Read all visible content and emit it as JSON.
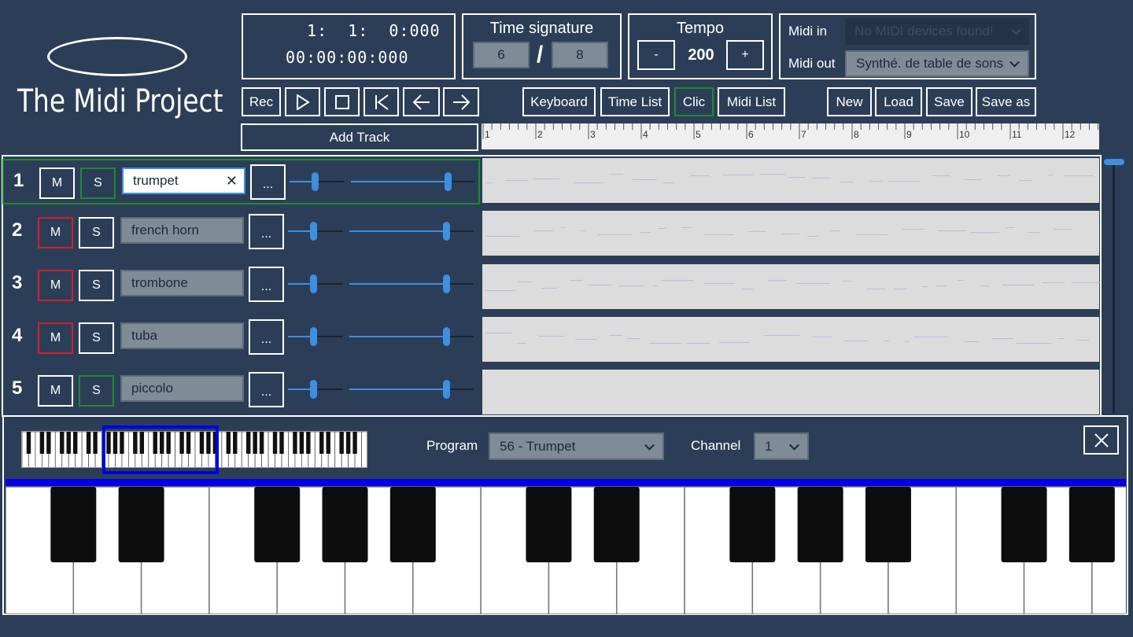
{
  "app": {
    "title": "The Midi Project"
  },
  "time": {
    "position": " 1:  1:  0:000",
    "clock": "00:00:00:000"
  },
  "time_signature": {
    "title": "Time signature",
    "numerator": "6",
    "separator": "/",
    "denominator": "8"
  },
  "tempo": {
    "title": "Tempo",
    "minus_label": "-",
    "value": "200",
    "plus_label": "+"
  },
  "midi": {
    "in_label": "Midi in",
    "in_value": "No MIDI devices found!",
    "out_label": "Midi out",
    "out_value": "Synthé. de table de sons"
  },
  "toolbar": {
    "rec_label": "Rec",
    "keyboard_label": "Keyboard",
    "timelist_label": "Time List",
    "clic_label": "Clic",
    "midilist_label": "Midi List",
    "new_label": "New",
    "load_label": "Load",
    "save_label": "Save",
    "saveas_label": "Save as",
    "add_track_label": "Add Track"
  },
  "ruler": {
    "bars": [
      "1",
      "2",
      "3",
      "4",
      "5",
      "6",
      "7",
      "8",
      "9",
      "10",
      "11",
      "12"
    ]
  },
  "tracks": [
    {
      "number": "1",
      "mute_label": "M",
      "solo_label": "S",
      "name": "trumpet",
      "more_label": "...",
      "muted": false,
      "solo": true,
      "selected": true,
      "volume": 0.45,
      "pan": 0.78
    },
    {
      "number": "2",
      "mute_label": "M",
      "solo_label": "S",
      "name": "french horn",
      "more_label": "...",
      "muted": true,
      "solo": false,
      "selected": false,
      "volume": 0.45,
      "pan": 0.78
    },
    {
      "number": "3",
      "mute_label": "M",
      "solo_label": "S",
      "name": "trombone",
      "more_label": "...",
      "muted": true,
      "solo": false,
      "selected": false,
      "volume": 0.45,
      "pan": 0.78
    },
    {
      "number": "4",
      "mute_label": "M",
      "solo_label": "S",
      "name": "tuba",
      "more_label": "...",
      "muted": true,
      "solo": false,
      "selected": false,
      "volume": 0.45,
      "pan": 0.78
    },
    {
      "number": "5",
      "mute_label": "M",
      "solo_label": "S",
      "name": "piccolo",
      "more_label": "...",
      "muted": false,
      "solo": true,
      "selected": false,
      "volume": 0.45,
      "pan": 0.78
    }
  ],
  "keyboard_panel": {
    "program_label": "Program",
    "program_value": "56 - Trumpet",
    "channel_label": "Channel",
    "channel_value": "1",
    "close_label": "✕"
  },
  "colors": {
    "background": "#2c3e57",
    "accent_blue": "#3d8fe0",
    "mute_red": "#d0202a",
    "solo_green": "#1e8a2e",
    "keyboard_blue": "#0000e6",
    "lane_grey": "#dcdcdc"
  }
}
